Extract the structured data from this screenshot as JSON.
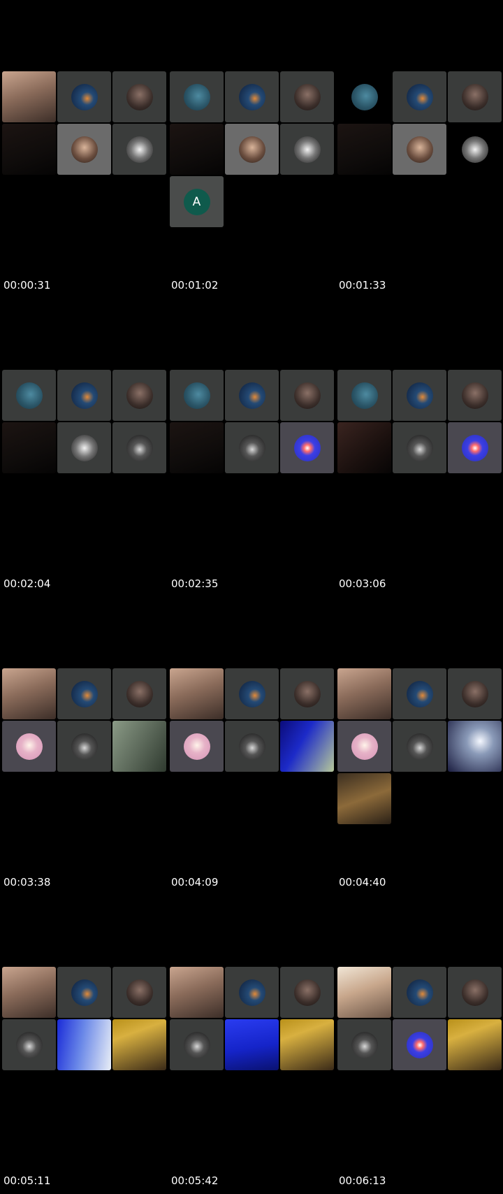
{
  "cells": [
    {
      "timestamp": "00:00:31"
    },
    {
      "timestamp": "00:01:02",
      "avatar_letter": "A"
    },
    {
      "timestamp": "00:01:33"
    },
    {
      "timestamp": "00:02:04"
    },
    {
      "timestamp": "00:02:35"
    },
    {
      "timestamp": "00:03:06"
    },
    {
      "timestamp": "00:03:38"
    },
    {
      "timestamp": "00:04:09"
    },
    {
      "timestamp": "00:04:40"
    },
    {
      "timestamp": "00:05:11"
    },
    {
      "timestamp": "00:05:42"
    },
    {
      "timestamp": "00:06:13"
    }
  ],
  "colors": {
    "background": "#000000",
    "tile": "#3a3c3b",
    "letter_avatar": "#0f5a4c"
  }
}
